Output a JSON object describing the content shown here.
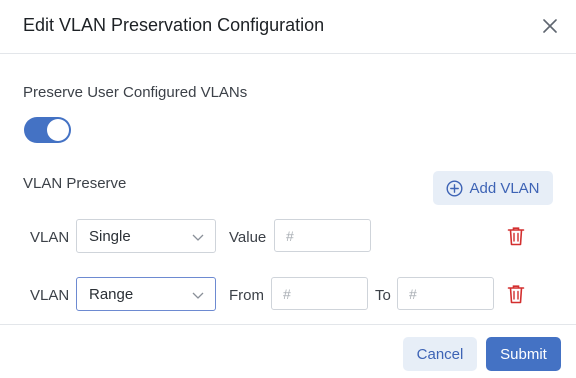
{
  "dialog": {
    "title": "Edit VLAN Preservation Configuration",
    "close_icon": "close-icon"
  },
  "preserve": {
    "label": "Preserve User Configured VLANs",
    "enabled": true
  },
  "vlan_preserve": {
    "label": "VLAN Preserve",
    "add_button": "Add VLAN",
    "add_icon": "plus-circle-icon",
    "rows": [
      {
        "vlan_label": "VLAN",
        "type": "Single",
        "value_label": "Value",
        "value_placeholder": "#"
      },
      {
        "vlan_label": "VLAN",
        "type": "Range",
        "from_label": "From",
        "from_placeholder": "#",
        "to_label": "To",
        "to_placeholder": "#"
      }
    ],
    "delete_icon": "trash-icon"
  },
  "footer": {
    "cancel": "Cancel",
    "submit": "Submit"
  },
  "colors": {
    "accent": "#4472c4",
    "danger": "#d32f2f",
    "secondary_bg": "#e7eef7"
  }
}
